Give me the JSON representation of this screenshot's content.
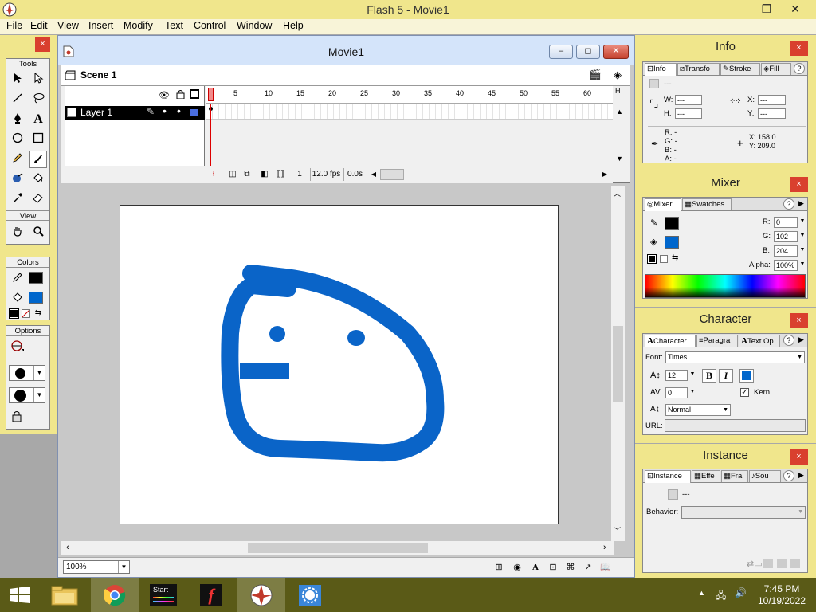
{
  "window": {
    "title": "Flash 5 - Movie1",
    "minimize": "–",
    "restore": "❐",
    "close": "✕"
  },
  "menu": [
    "File",
    "Edit",
    "View",
    "Insert",
    "Modify",
    "Text",
    "Control",
    "Window",
    "Help"
  ],
  "tools_panel": {
    "close": "×",
    "sections": {
      "tools": "Tools",
      "view": "View",
      "colors": "Colors",
      "options": "Options"
    },
    "selected_tool": "brush"
  },
  "movie": {
    "title": "Movie1",
    "minimize": "–",
    "restore": "◻",
    "close": "✕",
    "scene": "Scene 1",
    "layer": "Layer 1",
    "ruler": [
      "5",
      "10",
      "15",
      "20",
      "25",
      "30",
      "35",
      "40",
      "45",
      "50",
      "55",
      "60"
    ],
    "ruler_end": "H",
    "current_frame": "1",
    "frame_rate": "12.0 fps",
    "elapsed": "0.0s",
    "zoom": "100%",
    "drawing_color": "#0a64c8"
  },
  "info_panel": {
    "title": "Info",
    "close": "×",
    "tabs": [
      "Info",
      "Transfo",
      "Stroke",
      "Fill"
    ],
    "help": "?",
    "name_value": "---",
    "w_label": "W:",
    "w_value": "---",
    "h_label": "H:",
    "h_value": "---",
    "x_label": "X:",
    "x_value": "---",
    "y_label": "Y:",
    "y_value": "---",
    "r": "R: -",
    "g": "G: -",
    "b": "B: -",
    "a": "A: -",
    "cursor_x": "X: 158.0",
    "cursor_y": "Y: 209.0"
  },
  "mixer_panel": {
    "title": "Mixer",
    "close": "×",
    "tabs": [
      "Mixer",
      "Swatches"
    ],
    "help": "?",
    "r_label": "R:",
    "r_value": "0",
    "g_label": "G:",
    "g_value": "102",
    "b_label": "B:",
    "b_value": "204",
    "alpha_label": "Alpha:",
    "alpha_value": "100%",
    "stroke_color": "#000000",
    "fill_color": "#0066cc"
  },
  "character_panel": {
    "title": "Character",
    "close": "×",
    "tabs": [
      "Character",
      "Paragra",
      "Text Op"
    ],
    "help": "?",
    "font_label": "Font:",
    "font_value": "Times",
    "size_value": "12",
    "bold": "B",
    "italic": "I",
    "tracking_value": "0",
    "kern_label": "Kern",
    "kern_checked": true,
    "baseline_value": "Normal",
    "url_label": "URL:",
    "url_value": "",
    "text_color": "#0066cc"
  },
  "instance_panel": {
    "title": "Instance",
    "close": "×",
    "tabs": [
      "Instance",
      "Effe",
      "Fra",
      "Sou"
    ],
    "help": "?",
    "name_value": "---",
    "behavior_label": "Behavior:",
    "behavior_value": ""
  },
  "taskbar": {
    "start_label": "Start",
    "time": "7:45 PM",
    "date": "10/19/2022"
  }
}
